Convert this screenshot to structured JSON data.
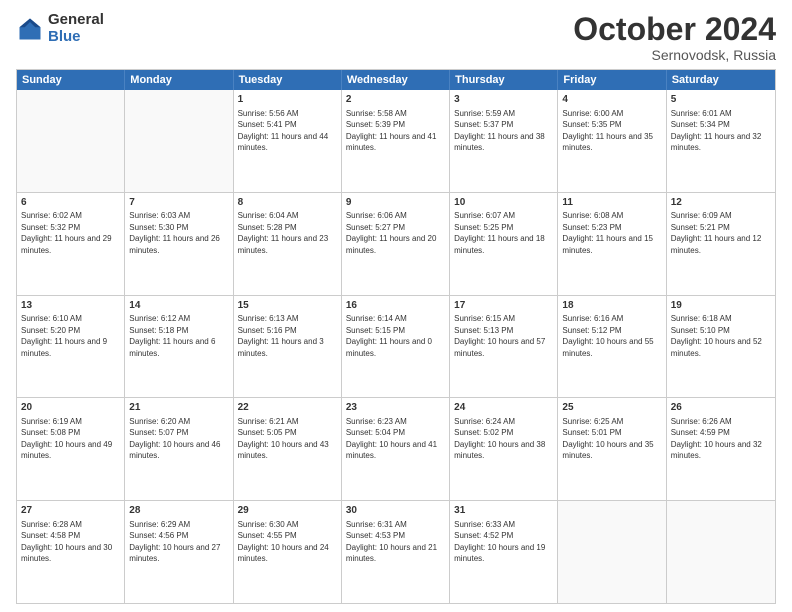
{
  "logo": {
    "general": "General",
    "blue": "Blue"
  },
  "header": {
    "month": "October 2024",
    "location": "Sernovodsk, Russia"
  },
  "weekdays": [
    "Sunday",
    "Monday",
    "Tuesday",
    "Wednesday",
    "Thursday",
    "Friday",
    "Saturday"
  ],
  "weeks": [
    [
      {
        "day": "",
        "text": ""
      },
      {
        "day": "",
        "text": ""
      },
      {
        "day": "1",
        "text": "Sunrise: 5:56 AM\nSunset: 5:41 PM\nDaylight: 11 hours and 44 minutes."
      },
      {
        "day": "2",
        "text": "Sunrise: 5:58 AM\nSunset: 5:39 PM\nDaylight: 11 hours and 41 minutes."
      },
      {
        "day": "3",
        "text": "Sunrise: 5:59 AM\nSunset: 5:37 PM\nDaylight: 11 hours and 38 minutes."
      },
      {
        "day": "4",
        "text": "Sunrise: 6:00 AM\nSunset: 5:35 PM\nDaylight: 11 hours and 35 minutes."
      },
      {
        "day": "5",
        "text": "Sunrise: 6:01 AM\nSunset: 5:34 PM\nDaylight: 11 hours and 32 minutes."
      }
    ],
    [
      {
        "day": "6",
        "text": "Sunrise: 6:02 AM\nSunset: 5:32 PM\nDaylight: 11 hours and 29 minutes."
      },
      {
        "day": "7",
        "text": "Sunrise: 6:03 AM\nSunset: 5:30 PM\nDaylight: 11 hours and 26 minutes."
      },
      {
        "day": "8",
        "text": "Sunrise: 6:04 AM\nSunset: 5:28 PM\nDaylight: 11 hours and 23 minutes."
      },
      {
        "day": "9",
        "text": "Sunrise: 6:06 AM\nSunset: 5:27 PM\nDaylight: 11 hours and 20 minutes."
      },
      {
        "day": "10",
        "text": "Sunrise: 6:07 AM\nSunset: 5:25 PM\nDaylight: 11 hours and 18 minutes."
      },
      {
        "day": "11",
        "text": "Sunrise: 6:08 AM\nSunset: 5:23 PM\nDaylight: 11 hours and 15 minutes."
      },
      {
        "day": "12",
        "text": "Sunrise: 6:09 AM\nSunset: 5:21 PM\nDaylight: 11 hours and 12 minutes."
      }
    ],
    [
      {
        "day": "13",
        "text": "Sunrise: 6:10 AM\nSunset: 5:20 PM\nDaylight: 11 hours and 9 minutes."
      },
      {
        "day": "14",
        "text": "Sunrise: 6:12 AM\nSunset: 5:18 PM\nDaylight: 11 hours and 6 minutes."
      },
      {
        "day": "15",
        "text": "Sunrise: 6:13 AM\nSunset: 5:16 PM\nDaylight: 11 hours and 3 minutes."
      },
      {
        "day": "16",
        "text": "Sunrise: 6:14 AM\nSunset: 5:15 PM\nDaylight: 11 hours and 0 minutes."
      },
      {
        "day": "17",
        "text": "Sunrise: 6:15 AM\nSunset: 5:13 PM\nDaylight: 10 hours and 57 minutes."
      },
      {
        "day": "18",
        "text": "Sunrise: 6:16 AM\nSunset: 5:12 PM\nDaylight: 10 hours and 55 minutes."
      },
      {
        "day": "19",
        "text": "Sunrise: 6:18 AM\nSunset: 5:10 PM\nDaylight: 10 hours and 52 minutes."
      }
    ],
    [
      {
        "day": "20",
        "text": "Sunrise: 6:19 AM\nSunset: 5:08 PM\nDaylight: 10 hours and 49 minutes."
      },
      {
        "day": "21",
        "text": "Sunrise: 6:20 AM\nSunset: 5:07 PM\nDaylight: 10 hours and 46 minutes."
      },
      {
        "day": "22",
        "text": "Sunrise: 6:21 AM\nSunset: 5:05 PM\nDaylight: 10 hours and 43 minutes."
      },
      {
        "day": "23",
        "text": "Sunrise: 6:23 AM\nSunset: 5:04 PM\nDaylight: 10 hours and 41 minutes."
      },
      {
        "day": "24",
        "text": "Sunrise: 6:24 AM\nSunset: 5:02 PM\nDaylight: 10 hours and 38 minutes."
      },
      {
        "day": "25",
        "text": "Sunrise: 6:25 AM\nSunset: 5:01 PM\nDaylight: 10 hours and 35 minutes."
      },
      {
        "day": "26",
        "text": "Sunrise: 6:26 AM\nSunset: 4:59 PM\nDaylight: 10 hours and 32 minutes."
      }
    ],
    [
      {
        "day": "27",
        "text": "Sunrise: 6:28 AM\nSunset: 4:58 PM\nDaylight: 10 hours and 30 minutes."
      },
      {
        "day": "28",
        "text": "Sunrise: 6:29 AM\nSunset: 4:56 PM\nDaylight: 10 hours and 27 minutes."
      },
      {
        "day": "29",
        "text": "Sunrise: 6:30 AM\nSunset: 4:55 PM\nDaylight: 10 hours and 24 minutes."
      },
      {
        "day": "30",
        "text": "Sunrise: 6:31 AM\nSunset: 4:53 PM\nDaylight: 10 hours and 21 minutes."
      },
      {
        "day": "31",
        "text": "Sunrise: 6:33 AM\nSunset: 4:52 PM\nDaylight: 10 hours and 19 minutes."
      },
      {
        "day": "",
        "text": ""
      },
      {
        "day": "",
        "text": ""
      }
    ]
  ]
}
